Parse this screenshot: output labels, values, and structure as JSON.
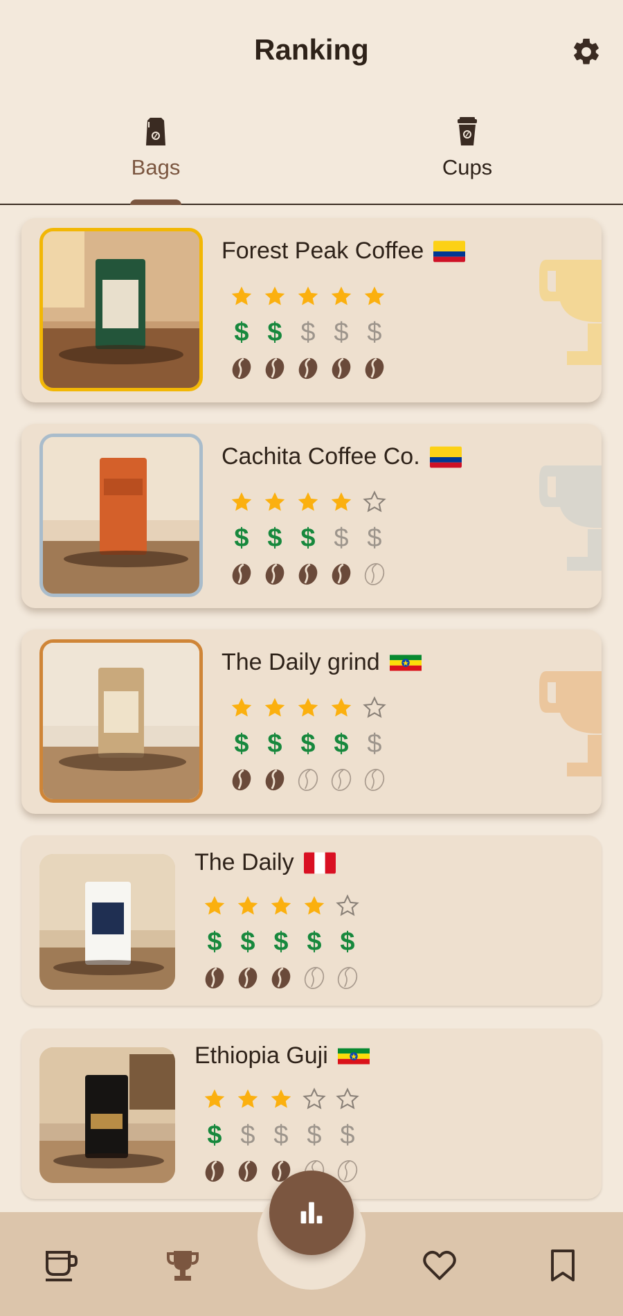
{
  "header": {
    "title": "Ranking",
    "settings_icon": "gear-icon"
  },
  "tabs": [
    {
      "label": "Bags",
      "icon": "coffee-bag-icon",
      "selected": true
    },
    {
      "label": "Cups",
      "icon": "coffee-cup-icon",
      "selected": false
    }
  ],
  "colors": {
    "background": "#f3e9dc",
    "card": "#eee0cf",
    "accent_brown": "#7b5640",
    "star": "#fbb00f",
    "dollar_on": "#17883d",
    "gold": "#f1c40f",
    "silver": "#a8b8c4",
    "bronze": "#d28a3d"
  },
  "items": [
    {
      "name": "Forest Peak Coffee",
      "flag": "colombia-flag",
      "rank_badge": "gold",
      "stars": 5,
      "price": 2,
      "strength": 5
    },
    {
      "name": "Cachita Coffee Co.",
      "flag": "colombia-flag",
      "rank_badge": "silver",
      "stars": 4,
      "price": 3,
      "strength": 4
    },
    {
      "name": "The Daily grind",
      "flag": "ethiopia-flag",
      "rank_badge": "bronze",
      "stars": 4,
      "price": 4,
      "strength": 2
    },
    {
      "name": "The Daily",
      "flag": "peru-flag",
      "rank_badge": "",
      "stars": 4,
      "price": 5,
      "strength": 3
    },
    {
      "name": "Ethiopia Guji",
      "flag": "ethiopia-flag",
      "rank_badge": "",
      "stars": 3,
      "price": 1,
      "strength": 3
    }
  ],
  "rating_max": 5,
  "bottom_nav": {
    "items": [
      {
        "icon": "coffee-mug-icon"
      },
      {
        "icon": "trophy-icon"
      },
      {
        "icon": "heart-icon"
      },
      {
        "icon": "bookmark-icon"
      }
    ],
    "fab_icon": "bar-chart-icon"
  }
}
